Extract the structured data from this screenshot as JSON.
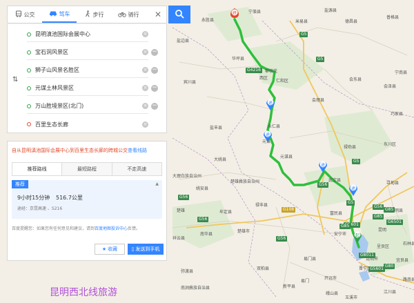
{
  "tabs": [
    {
      "label": "公交",
      "icon": "bus-icon"
    },
    {
      "label": "驾车",
      "icon": "car-icon",
      "active": true
    },
    {
      "label": "步行",
      "icon": "walk-icon"
    },
    {
      "label": "骑行",
      "icon": "bike-icon"
    }
  ],
  "close_glyph": "✕",
  "stops": [
    {
      "label": "昆明滇池国际会展中心",
      "type": "start"
    },
    {
      "label": "宝石洞风景区",
      "type": "via"
    },
    {
      "label": "狮子山风景名胜区",
      "type": "via"
    },
    {
      "label": "元谋土林风景区",
      "type": "via"
    },
    {
      "label": "万山胜境景区(北门)",
      "type": "via"
    },
    {
      "label": "百里生态长廊",
      "type": "end"
    }
  ],
  "result": {
    "bus_tip": "自从昆明滇池国际会展中心到百里生态长廊的跨城公交",
    "bus_tip_link": "查看线路",
    "tabs": [
      "推荐路线",
      "最短路程",
      "不走高速"
    ],
    "recommend_badge": "推荐",
    "duration": "9小时15分钟",
    "distance": "516.7公里",
    "via": "途经：京昆高速 、S216",
    "tips_prefix": "百度提醒您：如果您有任何意见和建议，请到",
    "tips_link": "百度地图投诉中心",
    "tips_suffix": "反馈。",
    "fav_label": "收藏",
    "send_label": "发送到手机"
  },
  "map": {
    "places": [
      "永仁县",
      "禄丰县",
      "武定县",
      "楚雄彝族自治州",
      "元谋县",
      "富民县",
      "昆明",
      "呈贡区",
      "晋宁区",
      "华坪县",
      "宾川县",
      "大姚县",
      "牟定县",
      "大理白族自治州",
      "姚安县",
      "南华县",
      "祥云县",
      "弥渡县",
      "双柏县",
      "易门县",
      "新平县",
      "峨山县",
      "玉溪市",
      "江川县",
      "禄劝县",
      "嵩明县",
      "宜良县",
      "寻甸县",
      "会泽县",
      "米易县",
      "盐边县",
      "盐源县",
      "攀枝花",
      "仁和区",
      "西区",
      "会理县",
      "会东县",
      "永胜县",
      "宁蒗县",
      "德昌县",
      "普格县",
      "宁南县",
      "巧家县",
      "东川区",
      "石林县",
      "路南县",
      "易门",
      "安宁市",
      "楚雄市",
      "开远市",
      "楚雄",
      "昆明市",
      "元谋",
      "盐丰县",
      "南涧彝族自治县"
    ],
    "route_labels": [
      "G4216",
      "G5",
      "G5",
      "G5",
      "G85",
      "G56",
      "G56",
      "G5",
      "G108",
      "G5601",
      "G56",
      "G85",
      "G6501",
      "G8011",
      "G56",
      "G80",
      "G5601",
      "G85",
      "G56"
    ],
    "marker_labels": [
      "终",
      "途",
      "途",
      "途",
      "途",
      "起"
    ]
  },
  "caption": "昆明西北线旅游",
  "colors": {
    "accent": "#3385ff",
    "route": "#2fbf3c",
    "start": "#2e9f4b",
    "end": "#e8452c",
    "caption": "#b14fd8"
  }
}
